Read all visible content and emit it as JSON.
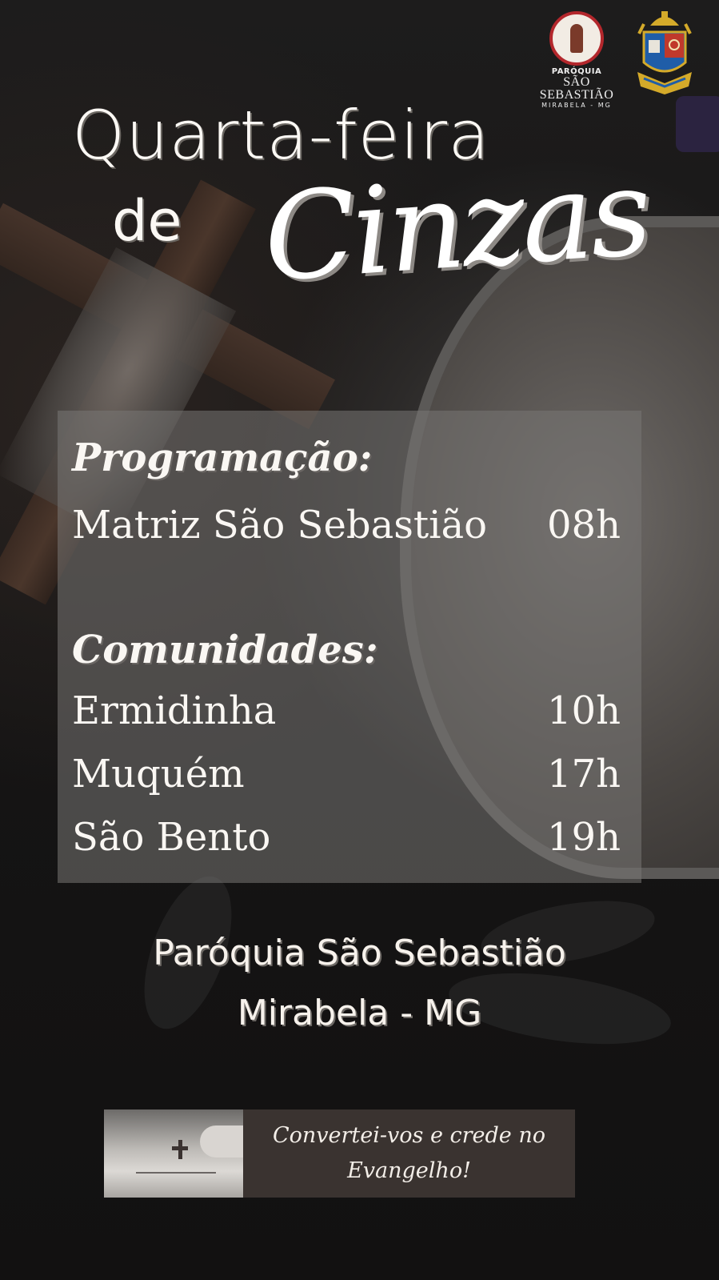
{
  "logos": {
    "parish": {
      "line1": "PARÓQUIA",
      "line2": "SÃO SEBASTIÃO",
      "line3": "MIRABELA - MG",
      "colors": {
        "ring": "#b3272c",
        "face": "#f2ece4"
      }
    },
    "diocese": {
      "icon": "diocese-coat-of-arms-icon",
      "colors": {
        "shield": "#1f5da8",
        "accent": "#d4aa2a",
        "red": "#c0392b"
      }
    }
  },
  "title": {
    "line1": "Quarta-feira",
    "line2": "de",
    "script": "Cinzas"
  },
  "schedule": {
    "main_heading": "Programação:",
    "main": [
      {
        "place": "Matriz São Sebastião",
        "time": "08h"
      }
    ],
    "communities_heading": "Comunidades:",
    "communities": [
      {
        "place": "Ermidinha",
        "time": "10h"
      },
      {
        "place": "Muquém",
        "time": "17h"
      },
      {
        "place": "São Bento",
        "time": "19h"
      }
    ]
  },
  "footer": {
    "line1": "Paróquia São Sebastião",
    "line2": "Mirabela - MG"
  },
  "quote": {
    "line1": "Convertei-vos e crede no",
    "line2": "Evangelho!"
  }
}
